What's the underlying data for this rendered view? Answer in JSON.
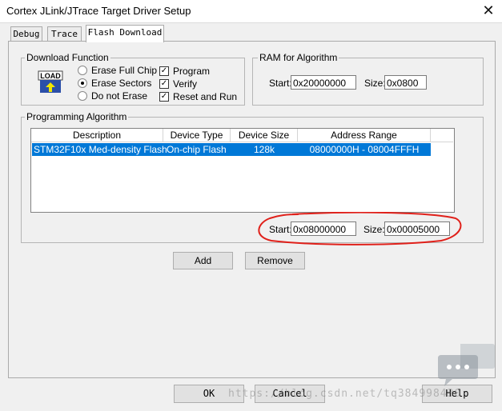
{
  "window": {
    "title": "Cortex JLink/JTrace Target Driver Setup"
  },
  "tabs": [
    {
      "label": "Debug"
    },
    {
      "label": "Trace"
    },
    {
      "label": "Flash Download"
    }
  ],
  "download_function": {
    "legend": "Download Function",
    "icon_text": "LOAD",
    "radios": [
      {
        "label": "Erase Full Chip",
        "selected": false
      },
      {
        "label": "Erase Sectors",
        "selected": true
      },
      {
        "label": "Do not Erase",
        "selected": false
      }
    ],
    "checks": [
      {
        "label": "Program",
        "checked": true
      },
      {
        "label": "Verify",
        "checked": true
      },
      {
        "label": "Reset and Run",
        "checked": true
      }
    ]
  },
  "ram": {
    "legend": "RAM for Algorithm",
    "start_label": "Start:",
    "start_value": "0x20000000",
    "size_label": "Size:",
    "size_value": "0x0800"
  },
  "programming": {
    "legend": "Programming Algorithm",
    "columns": [
      "Description",
      "Device Type",
      "Device Size",
      "Address Range"
    ],
    "rows": [
      {
        "description": "STM32F10x Med-density Flash",
        "device_type": "On-chip Flash",
        "device_size": "128k",
        "address_range": "08000000H - 08004FFFH"
      }
    ],
    "start_label": "Start:",
    "start_value": "0x08000000",
    "size_label": "Size:",
    "size_value": "0x00005000",
    "add_label": "Add",
    "remove_label": "Remove"
  },
  "footer": {
    "ok_label": "OK",
    "cancel_label": "Cancel",
    "help_label": "Help"
  },
  "watermark": "https://blog.csdn.net/tq384998430",
  "colors": {
    "selection": "#0078d7",
    "annotation": "#e0201a"
  }
}
